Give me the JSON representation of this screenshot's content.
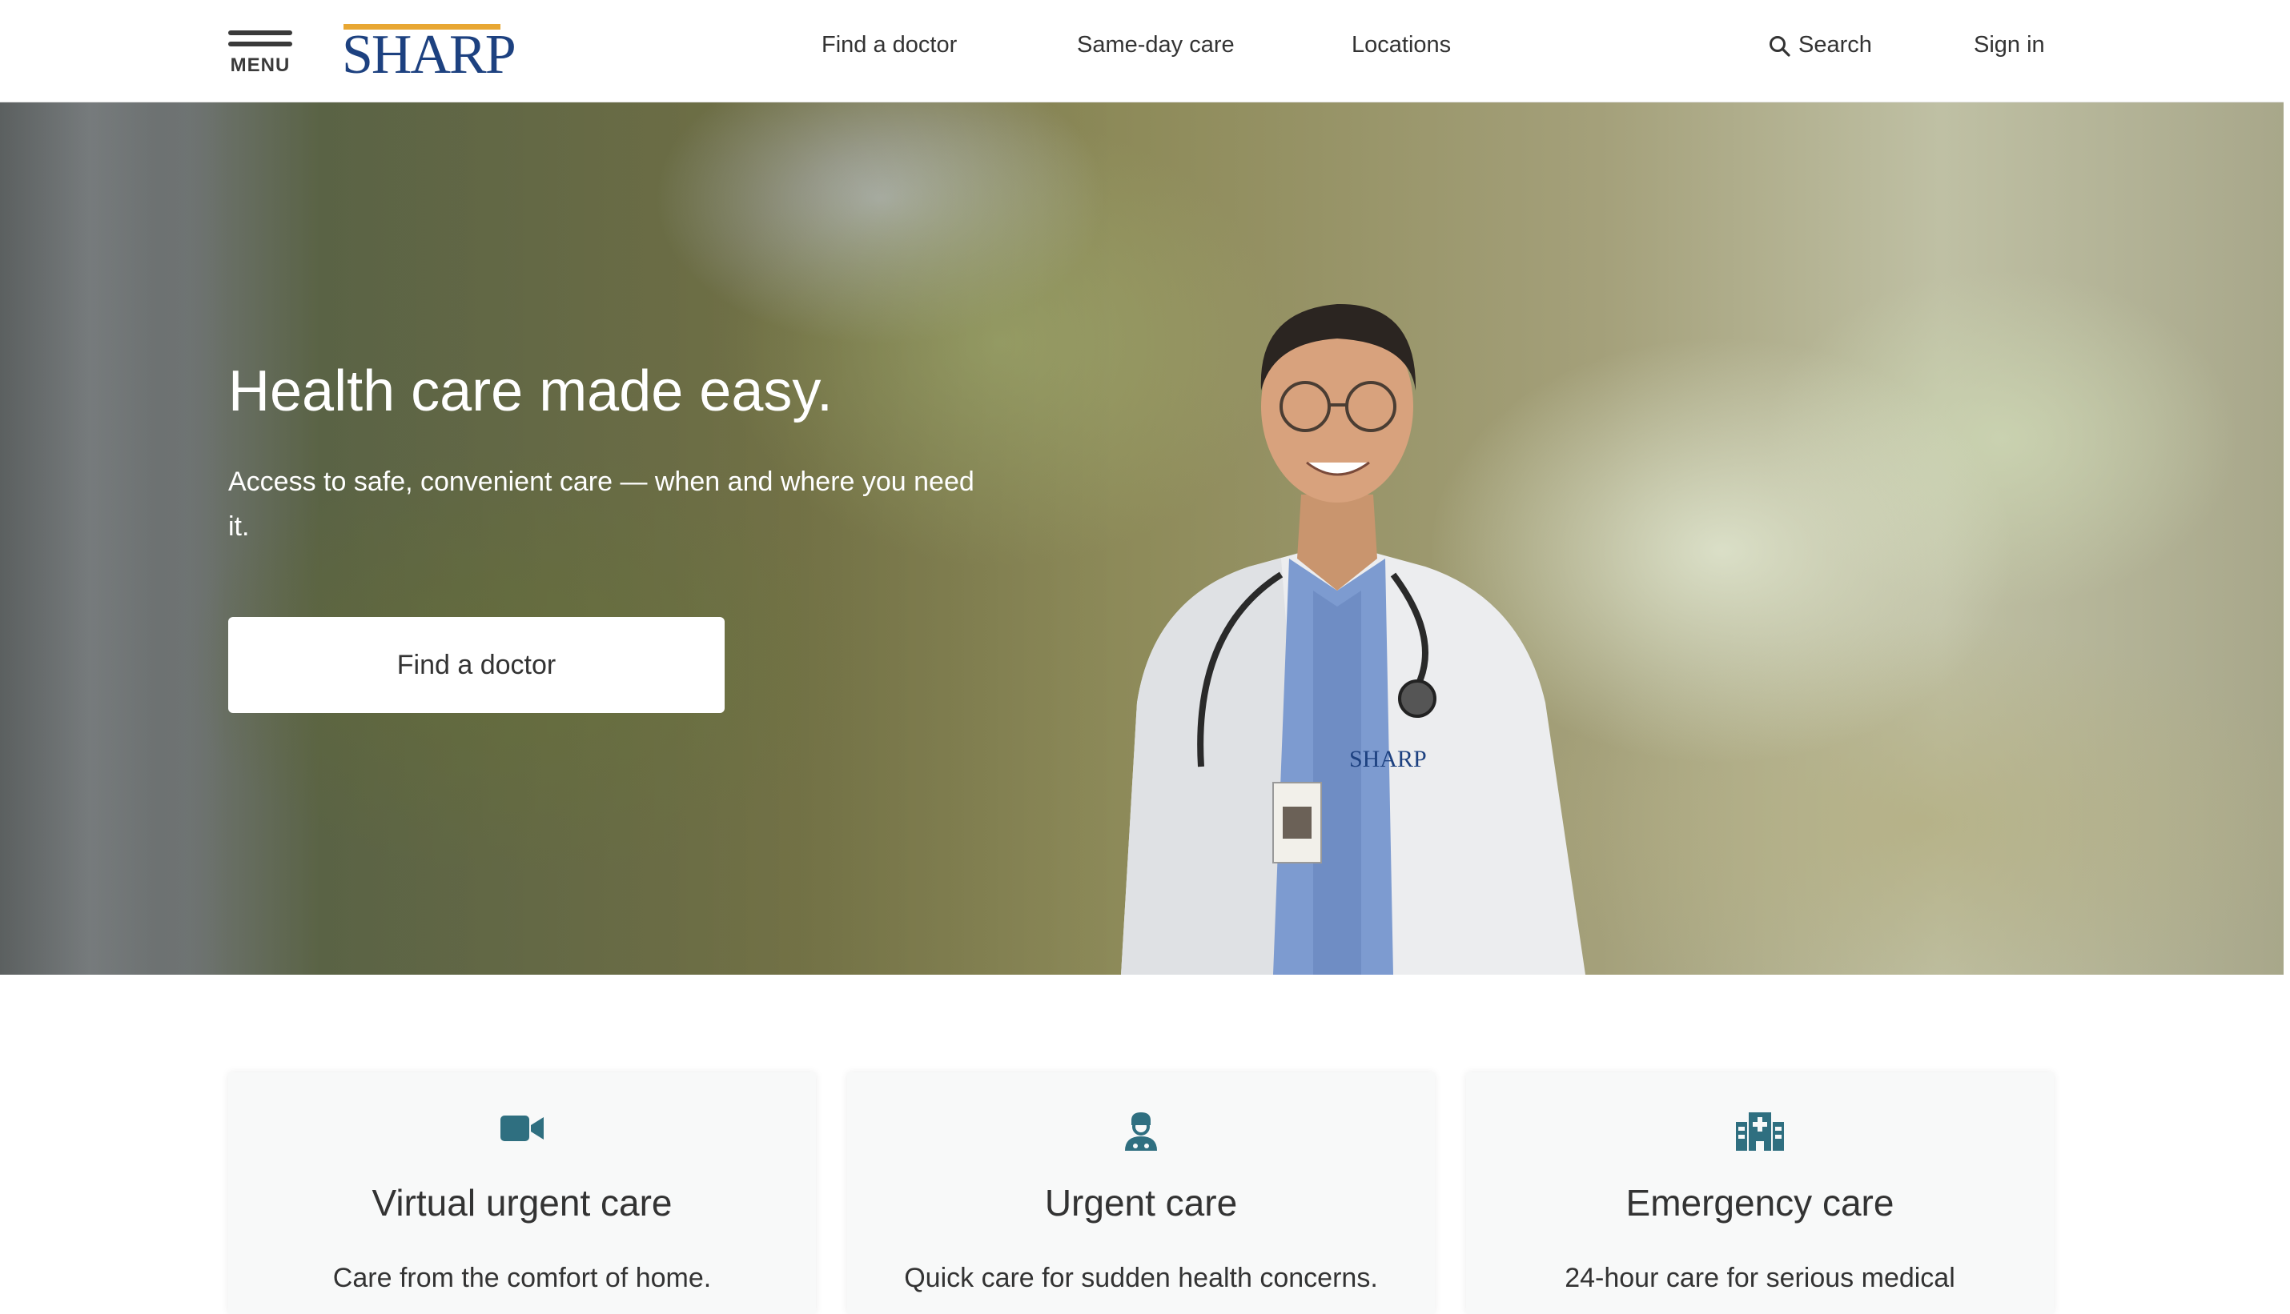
{
  "header": {
    "menu_label": "MENU",
    "logo_text": "SHARP",
    "nav": [
      {
        "label": "Find a doctor"
      },
      {
        "label": "Same-day care"
      },
      {
        "label": "Locations"
      }
    ],
    "search_label": "Search",
    "signin_label": "Sign in"
  },
  "hero": {
    "title": "Health care made easy.",
    "subtitle": "Access to safe, convenient care — when and where you need it.",
    "cta_label": "Find a doctor",
    "coat_logo_text": "SHARP"
  },
  "cards": [
    {
      "icon": "video-camera-icon",
      "title": "Virtual urgent care",
      "desc": "Care from the comfort of home."
    },
    {
      "icon": "doctor-icon",
      "title": "Urgent care",
      "desc": "Quick care for sudden health concerns."
    },
    {
      "icon": "hospital-icon",
      "title": "Emergency care",
      "desc": "24-hour care for serious medical"
    }
  ],
  "colors": {
    "brand_navy": "#1d4180",
    "brand_gold": "#e8a733",
    "icon_teal": "#2f6f80",
    "text": "#333333"
  }
}
